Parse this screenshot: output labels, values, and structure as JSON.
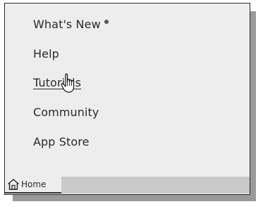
{
  "menu": {
    "items": [
      {
        "label": "What's New",
        "has_indicator": true
      },
      {
        "label": "Help"
      },
      {
        "label": "Tutorials",
        "hovered": true
      },
      {
        "label": "Community"
      },
      {
        "label": "App Store"
      }
    ]
  },
  "tabbar": {
    "home_tab_label": "Home",
    "home_icon": "home-icon"
  },
  "cursor": {
    "icon": "hand-pointer-icon"
  }
}
